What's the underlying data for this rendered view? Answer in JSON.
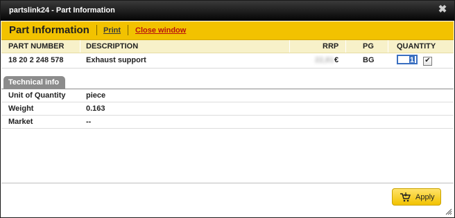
{
  "window": {
    "title": "partslink24 - Part Information",
    "close_glyph": "✖"
  },
  "header": {
    "title": "Part Information",
    "print_label": "Print",
    "close_window_label": "Close window"
  },
  "table": {
    "columns": [
      "PART NUMBER",
      "DESCRIPTION",
      "RRP",
      "PG",
      "QUANTITY"
    ],
    "rows": [
      {
        "part_number": "18 20 2 248 578",
        "description": "Exhaust support",
        "rrp_blurred": "22,81",
        "currency": "€",
        "pg": "BG",
        "quantity": "1",
        "checked": true
      }
    ]
  },
  "technical_info": {
    "tab_label": "Technical info",
    "items": [
      {
        "label": "Unit of Quantity",
        "value": "piece"
      },
      {
        "label": "Weight",
        "value": "0.163"
      },
      {
        "label": "Market",
        "value": "--"
      }
    ]
  },
  "footer": {
    "apply_label": "Apply"
  },
  "colors": {
    "accent": "#f2c200",
    "title_bar": "#050505",
    "close_link": "#b8120e"
  }
}
